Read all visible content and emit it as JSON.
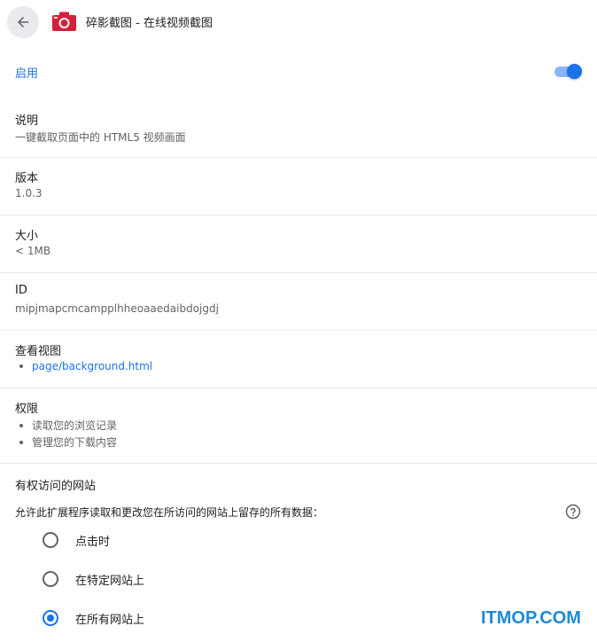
{
  "header": {
    "back_icon": "arrow-left-icon",
    "extension_icon": "camera-icon",
    "extension_icon_color": "#d2223a",
    "title": "碎影截图 - 在线视频截图"
  },
  "enable": {
    "label": "启用",
    "toggle_on": true,
    "accent_color": "#1a73e8"
  },
  "details": [
    {
      "key": "description",
      "label": "说明",
      "value": "一键截取页面中的 HTML5 视频画面"
    },
    {
      "key": "version",
      "label": "版本",
      "value": "1.0.3"
    },
    {
      "key": "size",
      "label": "大小",
      "value": "< 1MB"
    },
    {
      "key": "id",
      "label": "ID",
      "value": "mipjmapcmcampplhheoaaedaibdojgdj"
    }
  ],
  "views": {
    "label": "查看视图",
    "items": [
      "page/background.html"
    ]
  },
  "permissions": {
    "label": "权限",
    "items": [
      "读取您的浏览记录",
      "管理您的下载内容"
    ]
  },
  "site_access": {
    "label": "有权访问的网站",
    "description": "允许此扩展程序读取和更改您在所访问的网站上留存的所有数据：",
    "help_icon": "help-circle-icon",
    "options": [
      {
        "label": "点击时",
        "selected": false
      },
      {
        "label": "在特定网站上",
        "selected": false
      },
      {
        "label": "在所有网站上",
        "selected": true
      }
    ]
  },
  "watermark": "ITMOP.COM"
}
